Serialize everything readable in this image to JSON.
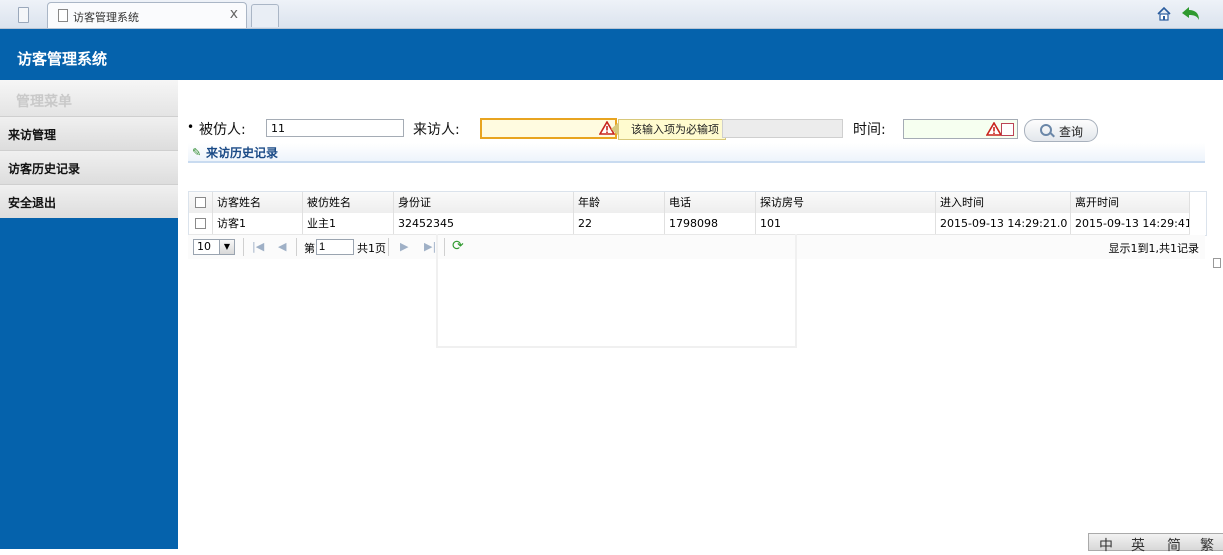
{
  "browser": {
    "tab_title": "访客管理系统",
    "tab_close": "x"
  },
  "header": {
    "title": "访客管理系统"
  },
  "sidebar": {
    "menu_title": "管理菜单",
    "items": [
      {
        "label": "来访管理"
      },
      {
        "label": "访客历史记录"
      },
      {
        "label": "安全退出"
      }
    ]
  },
  "search": {
    "bullet": "•",
    "host_label": "被仿人:",
    "host_value": "11",
    "visitor_label": "来访人:",
    "visitor_value": "",
    "required_tip": "该输入项为必输项",
    "time_label": "时间:",
    "search_button": "查询"
  },
  "panel": {
    "title": "来访历史记录"
  },
  "grid": {
    "columns": [
      "访客姓名",
      "被仿姓名",
      "身份证",
      "年龄",
      "电话",
      "探访房号",
      "进入时间",
      "离开时间"
    ],
    "rows": [
      [
        "访客1",
        "业主1",
        "32452345",
        "22",
        "1798098",
        "101",
        "2015-09-13 14:29:21.0",
        "2015-09-13 14:29:41"
      ]
    ]
  },
  "pager": {
    "page_size": "10",
    "page_prefix": "第",
    "page_number": "1",
    "page_total": "共1页",
    "info": "显示1到1,共1记录"
  },
  "language": [
    "中",
    "英",
    "简",
    "繁"
  ]
}
